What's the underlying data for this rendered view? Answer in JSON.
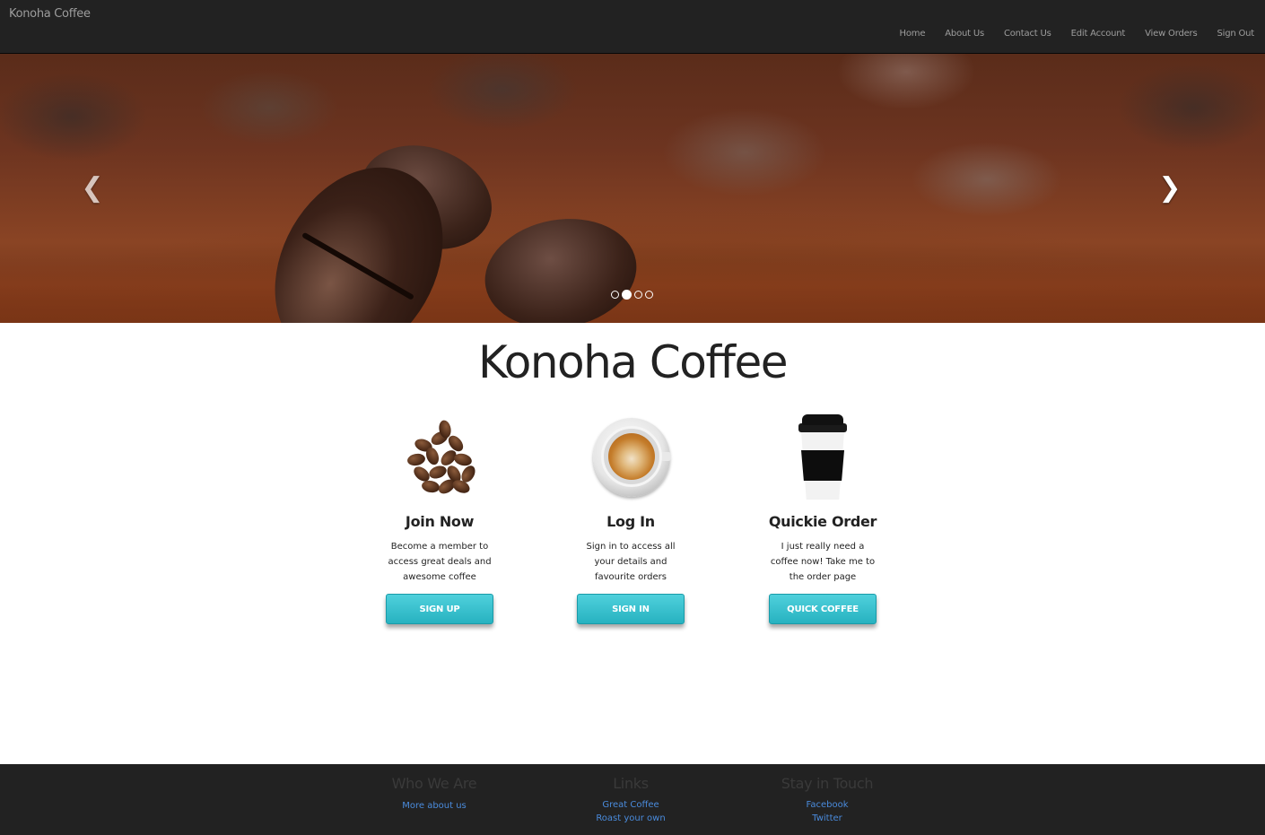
{
  "navbar": {
    "brand": "Konoha Coffee",
    "links": [
      "Home",
      "About Us",
      "Contact Us",
      "Edit Account",
      "View Orders",
      "Sign Out"
    ]
  },
  "carousel": {
    "prev_icon": "chevron-left-icon",
    "next_icon": "chevron-right-icon",
    "slide_count": 4,
    "active_slide": 2,
    "image": "coffee beans on ground coffee"
  },
  "main": {
    "title": "Konoha Coffee",
    "features": [
      {
        "image": "coffee-beans",
        "title": "Join Now",
        "description": "Become a member to access great deals and awesome coffee",
        "button": "SIGN UP"
      },
      {
        "image": "latte-cup",
        "title": "Log In",
        "description": "Sign in to access all your details and favourite orders",
        "button": "SIGN IN"
      },
      {
        "image": "takeaway-cup",
        "title": "Quickie Order",
        "description": "I just really need a coffee now! Take me to the order page",
        "button": "QUICK COFFEE"
      }
    ]
  },
  "footer": {
    "columns": [
      {
        "heading": "Who We Are",
        "links": [
          "More about us"
        ]
      },
      {
        "heading": "Links",
        "links": [
          "Great Coffee",
          "Roast your own"
        ]
      },
      {
        "heading": "Stay in Touch",
        "links": [
          "Facebook",
          "Twitter"
        ]
      }
    ]
  },
  "colors": {
    "navbar_bg": "#222222",
    "nav_text": "#9d9d9d",
    "button_accent": "#27b2c0",
    "footer_link": "#4a8bdc",
    "footer_heading": "#3a3a3a"
  }
}
